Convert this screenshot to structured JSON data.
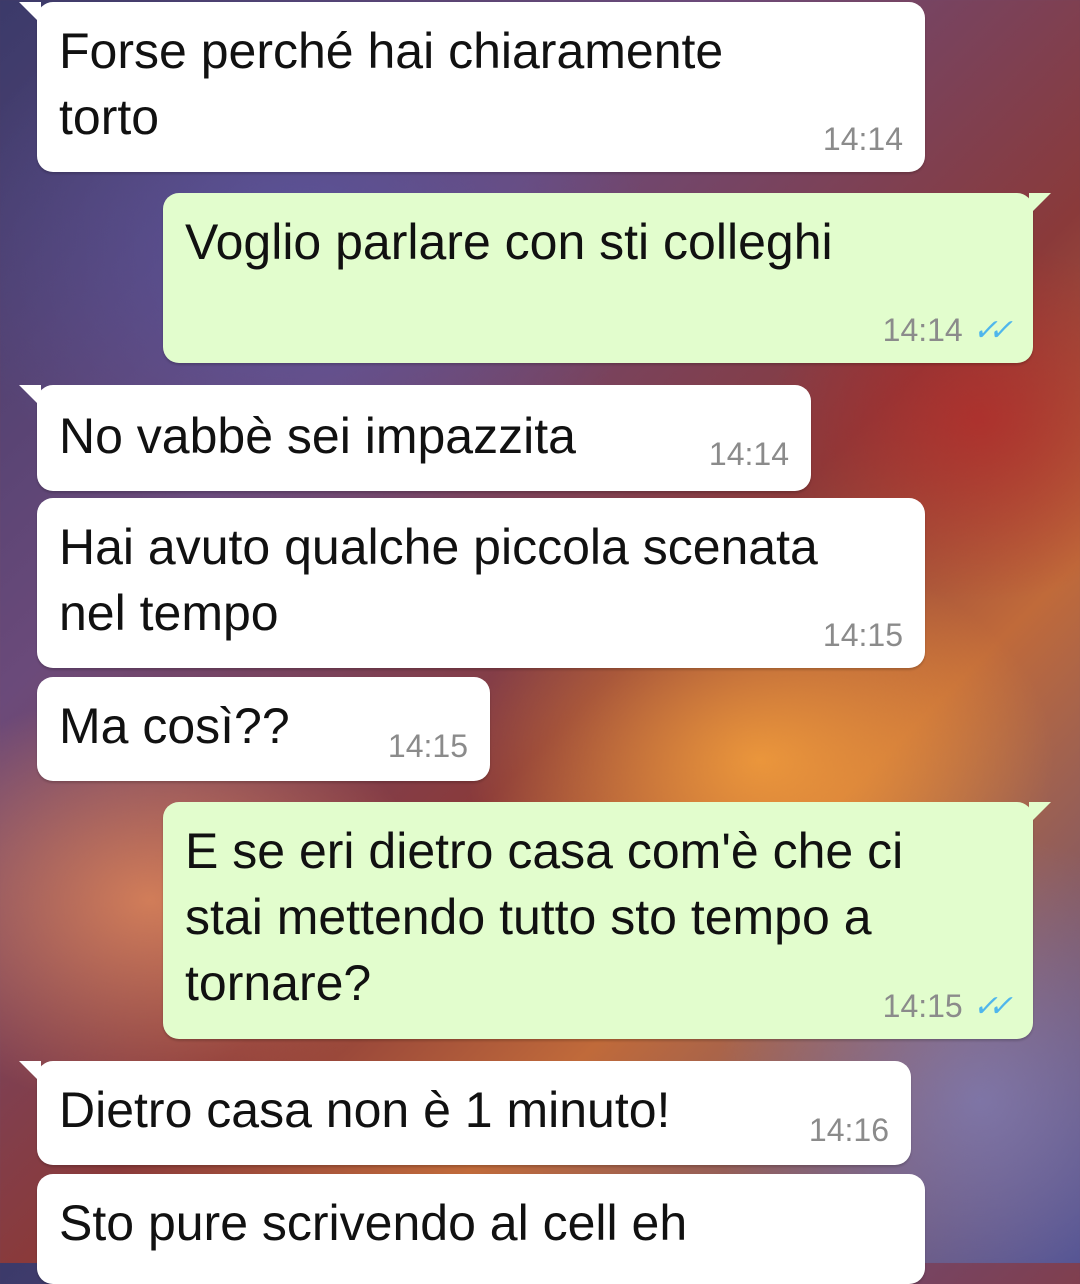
{
  "messages": [
    {
      "direction": "incoming",
      "text": "Forse perché hai chiaramente\ntorto",
      "time": "14:14"
    },
    {
      "direction": "outgoing",
      "text": "Voglio parlare con sti colleghi",
      "time": "14:14",
      "status": "read",
      "status_icon": "double-check-icon"
    },
    {
      "direction": "incoming",
      "text": "No vabbè sei impazzita",
      "time": "14:14"
    },
    {
      "direction": "incoming",
      "text": "Hai avuto qualche piccola scenata\nnel tempo",
      "time": "14:15"
    },
    {
      "direction": "incoming",
      "text": "Ma così??",
      "time": "14:15"
    },
    {
      "direction": "outgoing",
      "text": "E se eri dietro casa com'è che ci\nstai mettendo tutto sto tempo a\ntornare?",
      "time": "14:15",
      "status": "read",
      "status_icon": "double-check-icon"
    },
    {
      "direction": "incoming",
      "text": "Dietro casa non è 1 minuto!",
      "time": "14:16"
    },
    {
      "direction": "incoming",
      "text": "Sto pure scrivendo al cell eh",
      "time": ""
    }
  ],
  "colors": {
    "incoming_bubble": "#ffffff",
    "outgoing_bubble": "#e2fdcd",
    "read_ticks": "#4fb6ec",
    "timestamp": "#8b8b8b"
  }
}
